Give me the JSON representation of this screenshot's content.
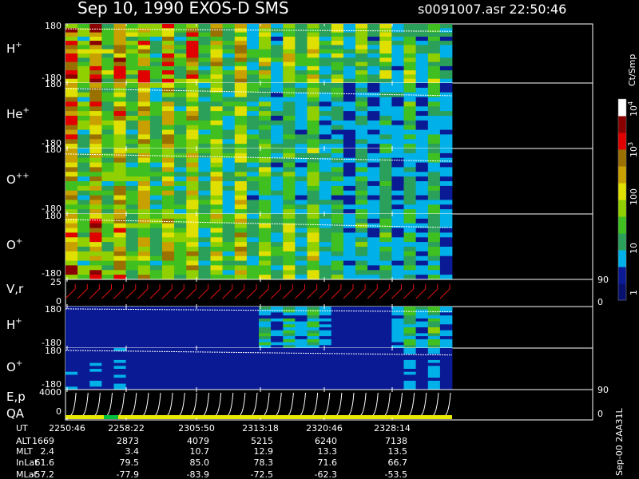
{
  "header": {
    "title": "Sep 10, 1990    EXOS-D SMS",
    "file_time": "s0091007.asr  22:50:46"
  },
  "colorbar": {
    "unit": "Ct/Smp",
    "ticks": [
      {
        "label": "1",
        "value": 1
      },
      {
        "label": "10",
        "value": 10
      },
      {
        "label": "100",
        "value": 100
      },
      {
        "label": "10",
        "sup": "3",
        "value": 1000
      },
      {
        "label": "10",
        "sup": "4",
        "value": 10000
      }
    ],
    "range": [
      0.5,
      20000
    ]
  },
  "footer": {
    "side_label": "Sep-00 2AA31L",
    "rows": [
      {
        "name": "UT",
        "values": [
          "2250:46",
          "2258:22",
          "2305:50",
          "2313:18",
          "2320:46",
          "2328:14"
        ]
      },
      {
        "name": "ALT",
        "values": [
          "1669",
          "2873",
          "4079",
          "5215",
          "6240",
          "7138"
        ]
      },
      {
        "name": "MLT",
        "values": [
          "2.4",
          "3.4",
          "10.7",
          "12.9",
          "13.3",
          "13.5"
        ]
      },
      {
        "name": "InLat",
        "values": [
          "61.6",
          "79.5",
          "85.0",
          "78.3",
          "71.6",
          "66.7"
        ]
      },
      {
        "name": "MLat",
        "values": [
          "-57.2",
          "-77.9",
          "-83.9",
          "-72.5",
          "-62.3",
          "-53.5"
        ]
      }
    ]
  },
  "chart_data": {
    "type": "heatmap",
    "time_ticks": [
      "2250:46",
      "2258:22",
      "2305:50",
      "2313:18",
      "2320:46",
      "2328:14"
    ],
    "spin_columns": 32,
    "panels": [
      {
        "id": "p1",
        "label": "H",
        "sup": "+",
        "ytop": "180",
        "ybot": "-180",
        "ylim": [
          -180,
          180
        ],
        "intensity": [
          3.6,
          3.2,
          2.8,
          2.4,
          2.2,
          2.0
        ],
        "phase_line_deg": [
          150,
          135
        ]
      },
      {
        "id": "p2",
        "label": "He",
        "sup": "+",
        "ytop": "180",
        "ybot": "-180",
        "ylim": [
          -180,
          180
        ],
        "intensity": [
          3.2,
          2.8,
          2.4,
          1.8,
          1.3,
          1.6
        ],
        "phase_line_deg": [
          150,
          110
        ]
      },
      {
        "id": "p3",
        "label": "O",
        "sup": "++",
        "ytop": "180",
        "ybot": "-180",
        "ylim": [
          -180,
          180
        ],
        "intensity": [
          3.0,
          2.6,
          2.3,
          1.9,
          1.4,
          1.5
        ],
        "phase_line_deg": [
          150,
          110
        ]
      },
      {
        "id": "p4",
        "label": "O",
        "sup": "+",
        "ytop": "180",
        "ybot": "-180",
        "ylim": [
          -180,
          180
        ],
        "intensity": [
          3.4,
          3.0,
          2.6,
          2.3,
          1.6,
          1.5
        ],
        "phase_line_deg": [
          150,
          105
        ]
      },
      {
        "id": "p5",
        "type": "line",
        "label": "V",
        "sub": ",r",
        "ytop": "25",
        "ybot": "0",
        "yright_top": "90",
        "yright_bot": "0",
        "ylim": [
          0,
          25
        ]
      },
      {
        "id": "p6",
        "label": "H",
        "sup": "+",
        "ytop": "180",
        "ybot": "-180",
        "ylim": [
          -180,
          180
        ],
        "intensity": [
          0.4,
          0.3,
          0.3,
          1.4,
          0.3,
          1.6
        ],
        "phase_line_deg": [
          160,
          135
        ]
      },
      {
        "id": "p7",
        "label": "O",
        "sup": "+",
        "ytop": "180",
        "ybot": "-180",
        "ylim": [
          -180,
          180
        ],
        "intensity": [
          0.6,
          0.4,
          0.3,
          0.3,
          0.4,
          0.8
        ],
        "phase_line_deg": [
          160,
          120
        ]
      },
      {
        "id": "p8",
        "type": "line",
        "label": "E",
        "sub": ",p",
        "ytop": "4000",
        "ybot": "0",
        "yright_top": "90",
        "yright_bot": "0",
        "ylim": [
          0,
          4000
        ],
        "qa_label": "QA"
      }
    ]
  }
}
